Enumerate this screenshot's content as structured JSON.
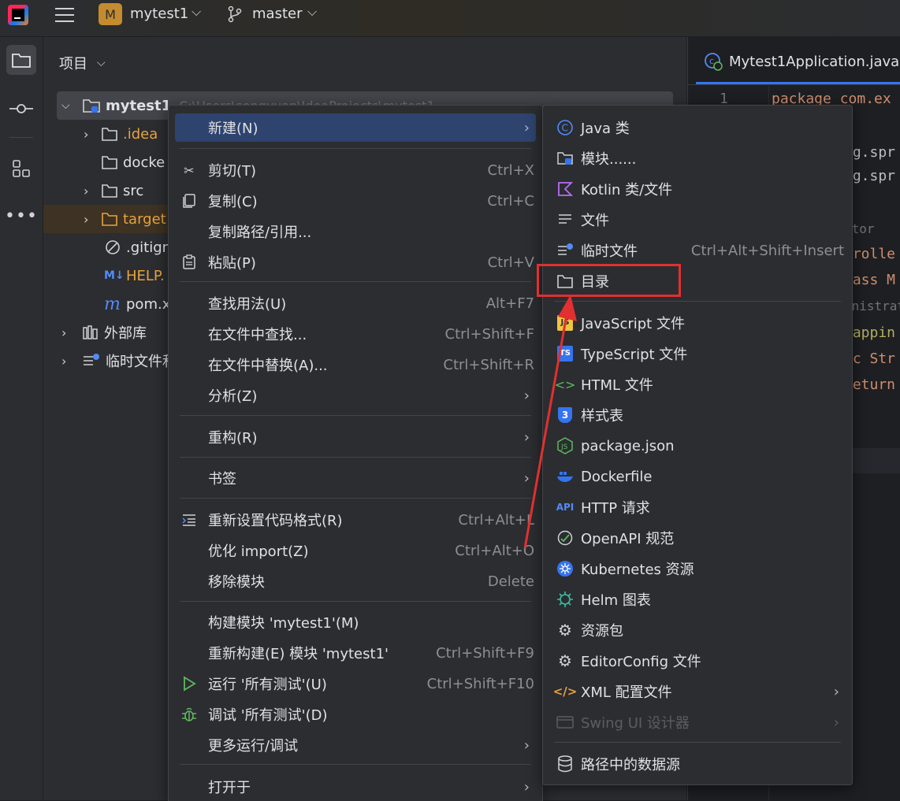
{
  "titlebar": {
    "project_letter": "M",
    "project_name": "mytest1",
    "branch": "master"
  },
  "project_panel": {
    "title": "项目",
    "tree": [
      {
        "label": "mytest1",
        "path": "C:\\Users\\songyuan\\IdeaProjects\\mytest1"
      },
      {
        "label": ".idea"
      },
      {
        "label": "docke"
      },
      {
        "label": "src"
      },
      {
        "label": "target"
      },
      {
        "label": ".gitign"
      },
      {
        "label": "HELP."
      },
      {
        "label": "pom.x"
      },
      {
        "label": "外部库"
      },
      {
        "label": "临时文件和"
      }
    ]
  },
  "editor": {
    "tab_label": "Mytest1Application.java",
    "line_number": "1",
    "lines": [
      "package com.ex",
      "rg.spr",
      "rg.spr",
      "ator",
      "trolle",
      "lass M",
      "inistrat",
      "Mappin",
      "ic Str",
      "return"
    ]
  },
  "context_menu": {
    "items": [
      {
        "label": "新建(N)",
        "shortcut": ""
      },
      {
        "label": "剪切(T)",
        "shortcut": "Ctrl+X"
      },
      {
        "label": "复制(C)",
        "shortcut": "Ctrl+C"
      },
      {
        "label": "复制路径/引用...",
        "shortcut": ""
      },
      {
        "label": "粘贴(P)",
        "shortcut": "Ctrl+V"
      },
      {
        "label": "查找用法(U)",
        "shortcut": "Alt+F7"
      },
      {
        "label": "在文件中查找...",
        "shortcut": "Ctrl+Shift+F"
      },
      {
        "label": "在文件中替换(A)...",
        "shortcut": "Ctrl+Shift+R"
      },
      {
        "label": "分析(Z)",
        "shortcut": ""
      },
      {
        "label": "重构(R)",
        "shortcut": ""
      },
      {
        "label": "书签",
        "shortcut": ""
      },
      {
        "label": "重新设置代码格式(R)",
        "shortcut": "Ctrl+Alt+L"
      },
      {
        "label": "优化 import(Z)",
        "shortcut": "Ctrl+Alt+O"
      },
      {
        "label": "移除模块",
        "shortcut": "Delete"
      },
      {
        "label": "构建模块 'mytest1'(M)",
        "shortcut": ""
      },
      {
        "label": "重新构建(E) 模块 'mytest1'",
        "shortcut": "Ctrl+Shift+F9"
      },
      {
        "label": "运行 '所有测试'(U)",
        "shortcut": "Ctrl+Shift+F10"
      },
      {
        "label": "调试 '所有测试'(D)",
        "shortcut": ""
      },
      {
        "label": "更多运行/调试",
        "shortcut": ""
      },
      {
        "label": "打开于",
        "shortcut": ""
      }
    ]
  },
  "new_submenu": {
    "items": [
      {
        "label": "Java 类",
        "shortcut": ""
      },
      {
        "label": "模块......",
        "shortcut": ""
      },
      {
        "label": "Kotlin 类/文件",
        "shortcut": ""
      },
      {
        "label": "文件",
        "shortcut": ""
      },
      {
        "label": "临时文件",
        "shortcut": "Ctrl+Alt+Shift+Insert"
      },
      {
        "label": "目录",
        "shortcut": ""
      },
      {
        "label": "JavaScript 文件",
        "shortcut": ""
      },
      {
        "label": "TypeScript 文件",
        "shortcut": ""
      },
      {
        "label": "HTML 文件",
        "shortcut": ""
      },
      {
        "label": "样式表",
        "shortcut": ""
      },
      {
        "label": "package.json",
        "shortcut": ""
      },
      {
        "label": "Dockerfile",
        "shortcut": ""
      },
      {
        "label": "HTTP 请求",
        "shortcut": ""
      },
      {
        "label": "OpenAPI 规范",
        "shortcut": ""
      },
      {
        "label": "Kubernetes 资源",
        "shortcut": ""
      },
      {
        "label": "Helm 图表",
        "shortcut": ""
      },
      {
        "label": "资源包",
        "shortcut": ""
      },
      {
        "label": "EditorConfig 文件",
        "shortcut": ""
      },
      {
        "label": "XML 配置文件",
        "shortcut": ""
      },
      {
        "label": "Swing UI 设计器",
        "shortcut": ""
      },
      {
        "label": "路径中的数据源",
        "shortcut": ""
      }
    ]
  },
  "icons": {
    "js_badge": "JS",
    "ts_badge": "TS",
    "api_badge": "API",
    "md_badge": "M↓",
    "css_badge": "3"
  },
  "colors": {
    "highlight": "#2e436e",
    "annotation_red": "#e03030",
    "accent_orange": "#e8a33d"
  }
}
